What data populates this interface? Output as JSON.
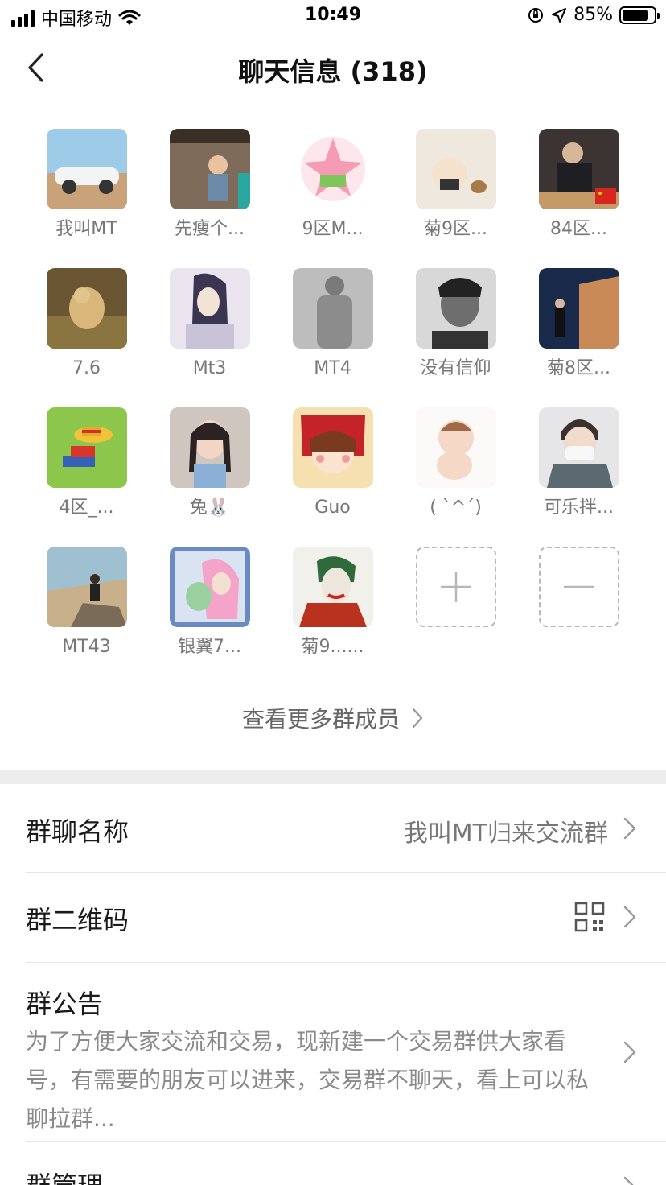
{
  "status_bar": {
    "carrier": "中国移动",
    "time": "10:49",
    "battery": "85%",
    "battery_level": 0.85
  },
  "nav": {
    "title": "聊天信息 (318)"
  },
  "members": [
    {
      "name": "我叫MT",
      "avatar": "sports-car-photo"
    },
    {
      "name": "先瘦个...",
      "avatar": "child-in-restaurant-photo"
    },
    {
      "name": "9区M...",
      "avatar": "patrick-star-sticker"
    },
    {
      "name": "菊9区...",
      "avatar": "cartoon-baby-sticker"
    },
    {
      "name": "84区...",
      "avatar": "man-at-table-photo"
    },
    {
      "name": "7.6",
      "avatar": "dog-in-field-photo"
    },
    {
      "name": "Mt3",
      "avatar": "anime-swordsman-drawing"
    },
    {
      "name": "MT4",
      "avatar": "bw-athlete-photo"
    },
    {
      "name": "没有信仰",
      "avatar": "bw-portrait-photo"
    },
    {
      "name": "菊8区...",
      "avatar": "night-wall-photo"
    },
    {
      "name": "4区_...",
      "avatar": "straw-hat-cartoon"
    },
    {
      "name": "兔🐰",
      "avatar": "girl-with-braids-photo"
    },
    {
      "name": "Guo",
      "avatar": "anime-girl-sticker"
    },
    {
      "name": "( ˋ^ˊ)",
      "avatar": "cartoon-pig-baby-sticker"
    },
    {
      "name": "可乐拌...",
      "avatar": "masked-boy-photo"
    },
    {
      "name": "MT43",
      "avatar": "man-on-rocks-photo"
    },
    {
      "name": "银翼7...",
      "avatar": "anime-couple-drawing"
    },
    {
      "name": "菊9......",
      "avatar": "joker-illustration"
    }
  ],
  "actions": {
    "add_icon": "plus-icon",
    "remove_icon": "minus-icon"
  },
  "more_members": {
    "label": "查看更多群成员"
  },
  "settings": {
    "group_name_label": "群聊名称",
    "group_name_value": "我叫MT归来交流群",
    "qr_label": "群二维码",
    "notice_label": "群公告",
    "notice_text": "为了方便大家交流和交易，现新建一个交易群供大家看号，有需要的朋友可以进来，交易群不聊天，看上可以私聊拉群...",
    "manage_label": "群管理"
  },
  "colors": {
    "accent_text": "#1a1a1a",
    "secondary_text": "#777777",
    "divider": "#ededed"
  }
}
